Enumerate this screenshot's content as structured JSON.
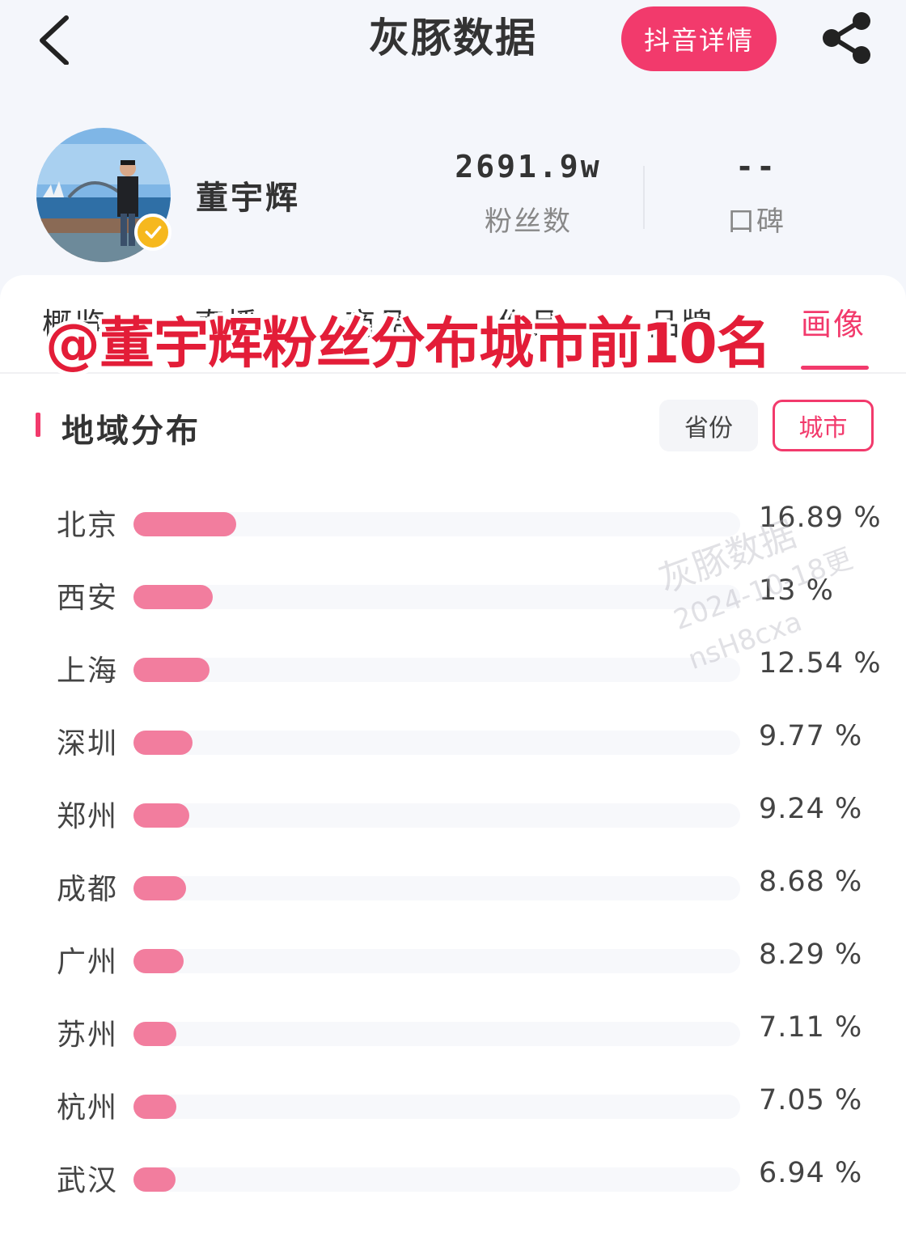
{
  "header": {
    "title": "灰豚数据",
    "douyin_button": "抖音详情"
  },
  "profile": {
    "name": "董宇辉",
    "fans_value": "2691.9w",
    "fans_label": "粉丝数",
    "reputation_value": "--",
    "reputation_label": "口碑"
  },
  "tabs": [
    "概览",
    "直播",
    "商品",
    "作品",
    "品牌",
    "画像"
  ],
  "active_tab": "画像",
  "overlay_text": "@董宇辉粉丝分布城市前10名",
  "section": {
    "title": "地域分布",
    "toggle_province": "省份",
    "toggle_city": "城市",
    "selected": "城市"
  },
  "chart_data": {
    "type": "bar",
    "categories": [
      "北京",
      "西安",
      "上海",
      "深圳",
      "郑州",
      "成都",
      "广州",
      "苏州",
      "杭州",
      "武汉"
    ],
    "values": [
      16.89,
      13,
      12.54,
      9.77,
      9.24,
      8.68,
      8.29,
      7.11,
      7.05,
      6.94
    ],
    "labels": [
      "16.89 %",
      "13 %",
      "12.54 %",
      "9.77 %",
      "9.24 %",
      "8.68 %",
      "8.29 %",
      "7.11 %",
      "7.05 %",
      "6.94 %"
    ],
    "xlim": [
      0,
      100
    ]
  },
  "watermark": {
    "line1": "灰豚数据",
    "line2": "2024-10-18更",
    "line3": "nsH8cxa"
  },
  "colors": {
    "accent": "#f23a6c",
    "bar": "#f27d9e",
    "overlay": "#e31d38",
    "verified": "#f6b81e"
  },
  "icons": [
    "back-arrow-icon",
    "share-icon",
    "verified-check-icon"
  ]
}
